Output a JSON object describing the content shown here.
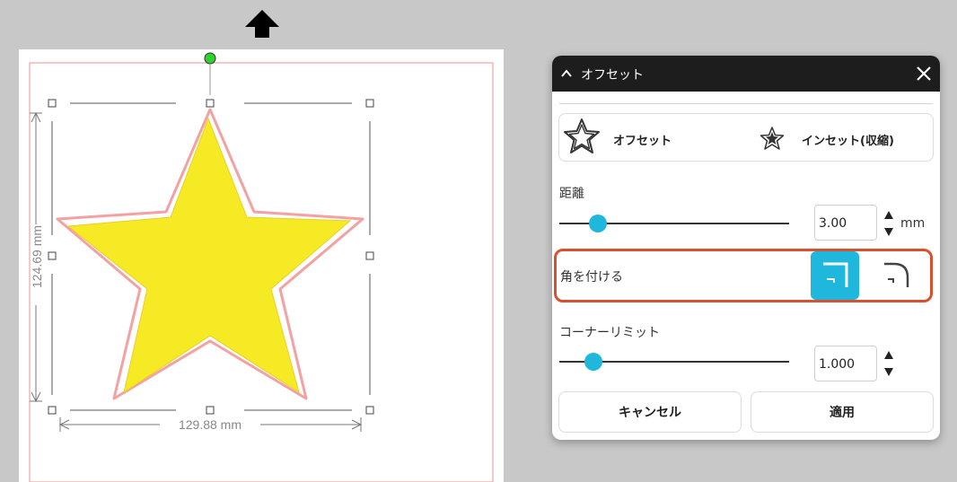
{
  "canvas": {
    "width_dimension": "129.88 mm",
    "height_dimension": "124.69 mm",
    "shape_fill": "#f6ea24",
    "shape_stroke": "#f2a2a2"
  },
  "panel": {
    "title": "オフセット",
    "mode": {
      "offset_label": "オフセット",
      "inset_label": "インセット(収縮)"
    },
    "distance": {
      "label": "距離",
      "value": "3.00",
      "unit": "mm",
      "slider_fraction": 0.14
    },
    "corner": {
      "label": "角を付ける",
      "selected": "square"
    },
    "corner_limit": {
      "label": "コーナーリミット",
      "value": "1.000",
      "slider_fraction": 0.12
    },
    "buttons": {
      "cancel": "キャンセル",
      "apply": "適用"
    }
  },
  "colors": {
    "accent": "#1fb8dc",
    "highlight_border": "#d9512c",
    "titlebar": "#1d1d1d"
  }
}
